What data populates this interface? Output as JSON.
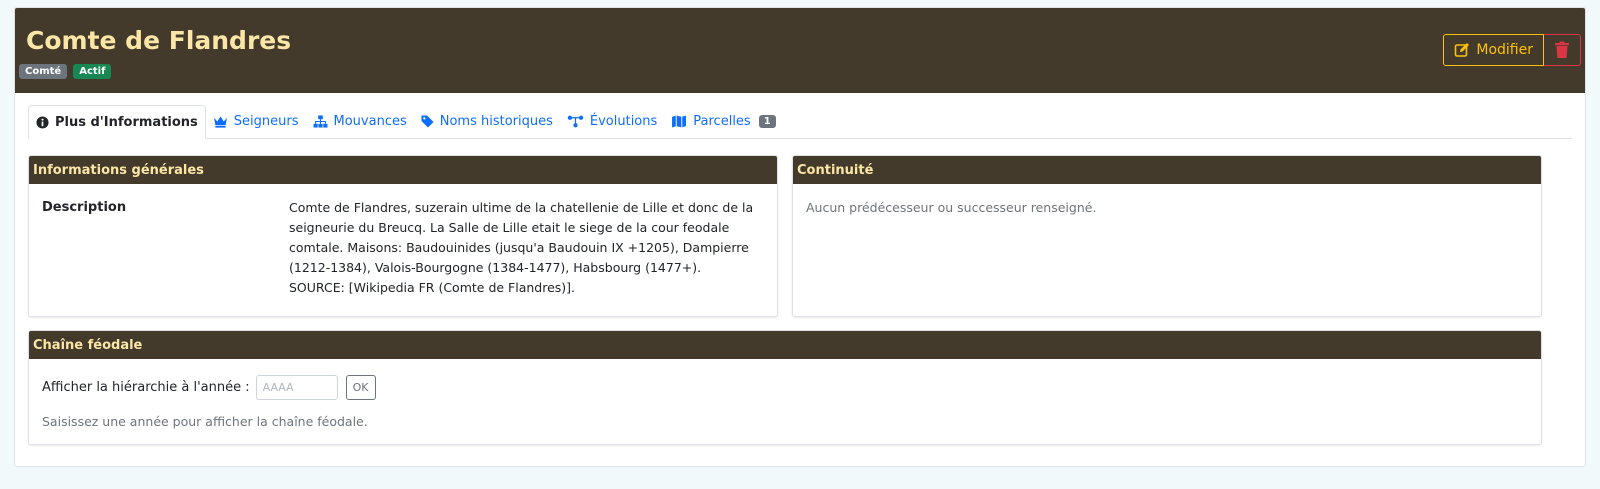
{
  "header": {
    "title": "Comte de Flandres",
    "badges": [
      "Comté",
      "Actif"
    ],
    "edit_label": "Modifier"
  },
  "tabs": [
    {
      "label": "Plus d'Informations",
      "icon": "info-icon"
    },
    {
      "label": "Seigneurs",
      "icon": "crown-icon"
    },
    {
      "label": "Mouvances",
      "icon": "hierarchy-icon"
    },
    {
      "label": "Noms historiques",
      "icon": "tag-icon"
    },
    {
      "label": "Évolutions",
      "icon": "network-icon"
    },
    {
      "label": "Parcelles",
      "icon": "map-icon",
      "count": "1"
    }
  ],
  "general": {
    "title": "Informations générales",
    "description_label": "Description",
    "description": "Comte de Flandres, suzerain ultime de la chatellenie de Lille et donc de la seigneurie du Breucq. La Salle de Lille etait le siege de la cour feodale comtale. Maisons: Baudouinides (jusqu'a Baudouin IX +1205), Dampierre (1212-1384), Valois-Bourgogne (1384-1477), Habsbourg (1477+). SOURCE: [Wikipedia FR (Comte de Flandres)]."
  },
  "continuity": {
    "title": "Continuité",
    "empty": "Aucun prédécesseur ou successeur renseigné."
  },
  "chain": {
    "title": "Chaîne féodale",
    "year_label": "Afficher la hiérarchie à l'année :",
    "year_placeholder": "AAAA",
    "ok_label": "OK",
    "hint": "Saisissez une année pour afficher la chaîne féodale."
  }
}
